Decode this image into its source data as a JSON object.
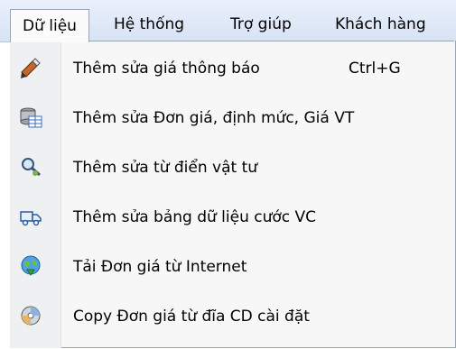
{
  "menubar": {
    "items": [
      {
        "label": "Dữ liệu"
      },
      {
        "label": "Hệ thống"
      },
      {
        "label": "Trợ giúp"
      },
      {
        "label": "Khách hàng"
      }
    ]
  },
  "dropdown": {
    "items": [
      {
        "label": "Thêm sửa giá thông báo",
        "shortcut": "Ctrl+G",
        "icon": "pencil-tool-icon"
      },
      {
        "label": "Thêm sửa Đơn giá, định mức, Giá VT",
        "icon": "database-table-icon"
      },
      {
        "label": "Thêm sửa từ điển vật tư",
        "icon": "dictionary-search-icon"
      },
      {
        "label": "Thêm sửa bảng dữ liệu cước VC",
        "icon": "truck-icon"
      },
      {
        "label": "Tải Đơn giá từ Internet",
        "icon": "globe-download-icon"
      },
      {
        "label": "Copy Đơn giá từ đĩa CD cài đặt",
        "icon": "cd-copy-icon"
      }
    ]
  }
}
